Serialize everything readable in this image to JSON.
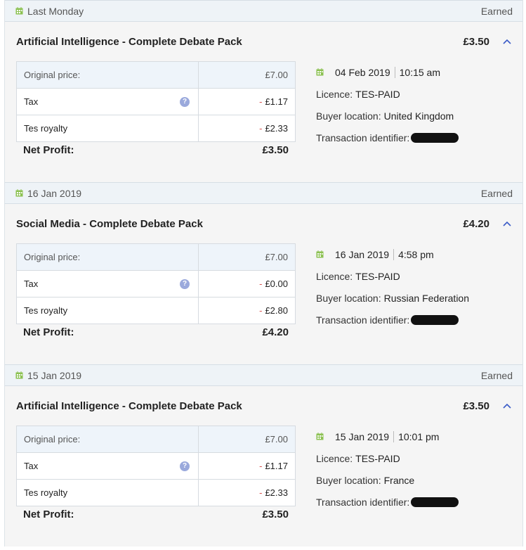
{
  "colors": {
    "calendar_icon": "#8cc152",
    "accent": "#3a5bc7",
    "negative": "#d9534f",
    "date_bar_bg": "#eef3f7",
    "entry_bg": "#f5f5f5"
  },
  "entries": [
    {
      "date_label": "Last Monday",
      "status": "Earned",
      "title": "Artificial Intelligence - Complete Debate Pack",
      "amount": "£3.50",
      "table": {
        "original_label": "Original price:",
        "original_value": "£7.00",
        "tax_label": "Tax",
        "tax_sign": "-",
        "tax_value": "£1.17",
        "royalty_label": "Tes royalty",
        "royalty_sign": "-",
        "royalty_value": "£2.33"
      },
      "net_label": "Net Profit:",
      "net_value": "£3.50",
      "details": {
        "date": "04 Feb 2019",
        "time": "10:15 am",
        "licence_label": "Licence:",
        "licence": "TES-PAID",
        "buyer_label": "Buyer location:",
        "buyer": "United Kingdom",
        "txn_label": "Transaction identifier:"
      }
    },
    {
      "date_label": "16 Jan 2019",
      "status": "Earned",
      "title": "Social Media - Complete Debate Pack",
      "amount": "£4.20",
      "table": {
        "original_label": "Original price:",
        "original_value": "£7.00",
        "tax_label": "Tax",
        "tax_sign": "-",
        "tax_value": "£0.00",
        "royalty_label": "Tes royalty",
        "royalty_sign": "-",
        "royalty_value": "£2.80"
      },
      "net_label": "Net Profit:",
      "net_value": "£4.20",
      "details": {
        "date": "16 Jan 2019",
        "time": "4:58 pm",
        "licence_label": "Licence:",
        "licence": "TES-PAID",
        "buyer_label": "Buyer location:",
        "buyer": "Russian Federation",
        "txn_label": "Transaction identifier:"
      }
    },
    {
      "date_label": "15 Jan 2019",
      "status": "Earned",
      "title": "Artificial Intelligence - Complete Debate Pack",
      "amount": "£3.50",
      "table": {
        "original_label": "Original price:",
        "original_value": "£7.00",
        "tax_label": "Tax",
        "tax_sign": "-",
        "tax_value": "£1.17",
        "royalty_label": "Tes royalty",
        "royalty_sign": "-",
        "royalty_value": "£2.33"
      },
      "net_label": "Net Profit:",
      "net_value": "£3.50",
      "details": {
        "date": "15 Jan 2019",
        "time": "10:01 pm",
        "licence_label": "Licence:",
        "licence": "TES-PAID",
        "buyer_label": "Buyer location:",
        "buyer": "France",
        "txn_label": "Transaction identifier:"
      }
    }
  ]
}
